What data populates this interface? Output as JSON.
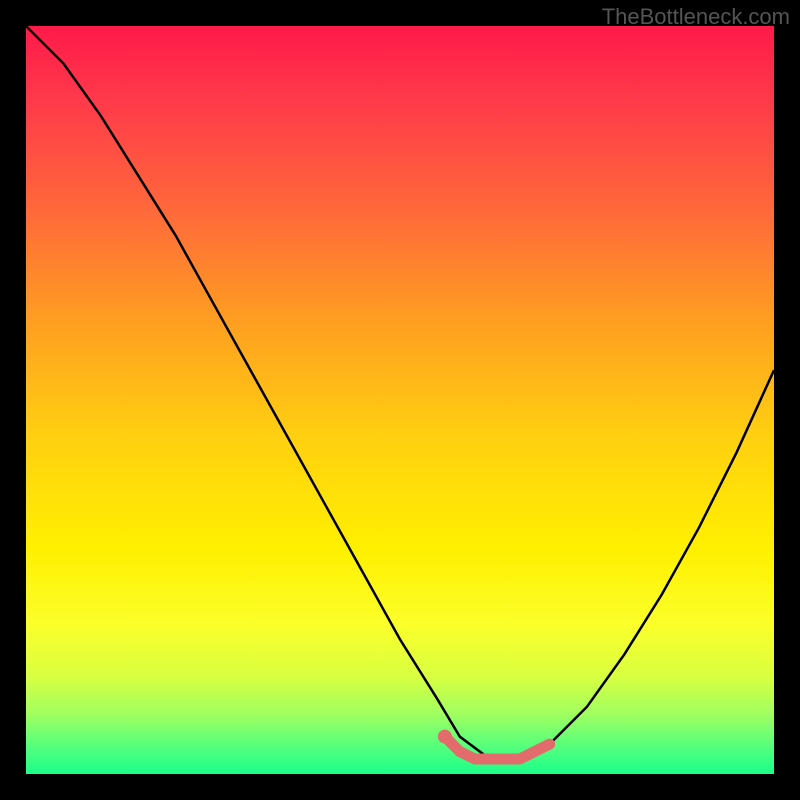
{
  "watermark": "TheBottleneck.com",
  "chart_data": {
    "type": "line",
    "title": "",
    "xlabel": "",
    "ylabel": "",
    "xlim": [
      0,
      100
    ],
    "ylim": [
      0,
      100
    ],
    "series": [
      {
        "name": "bottleneck-curve",
        "x": [
          0,
          5,
          10,
          15,
          20,
          25,
          30,
          35,
          40,
          45,
          50,
          55,
          58,
          62,
          66,
          70,
          75,
          80,
          85,
          90,
          95,
          100
        ],
        "values": [
          100,
          95,
          88,
          80,
          72,
          63,
          54,
          45,
          36,
          27,
          18,
          10,
          5,
          2,
          2,
          4,
          9,
          16,
          24,
          33,
          43,
          54
        ]
      }
    ],
    "highlight_segment": {
      "name": "optimal-zone",
      "color": "#e36b6b",
      "x": [
        56,
        58,
        60,
        62,
        64,
        66,
        68,
        70
      ],
      "values": [
        5,
        3,
        2,
        2,
        2,
        2,
        3,
        4
      ]
    },
    "highlight_point": {
      "name": "optimal-point",
      "x": 56,
      "value": 5,
      "color": "#e36b6b"
    },
    "gradient_stops": [
      {
        "pos": 0,
        "color": "#ff1a4a"
      },
      {
        "pos": 25,
        "color": "#ff6a3a"
      },
      {
        "pos": 55,
        "color": "#ffd010"
      },
      {
        "pos": 80,
        "color": "#fbff2a"
      },
      {
        "pos": 100,
        "color": "#1aff8a"
      }
    ]
  }
}
